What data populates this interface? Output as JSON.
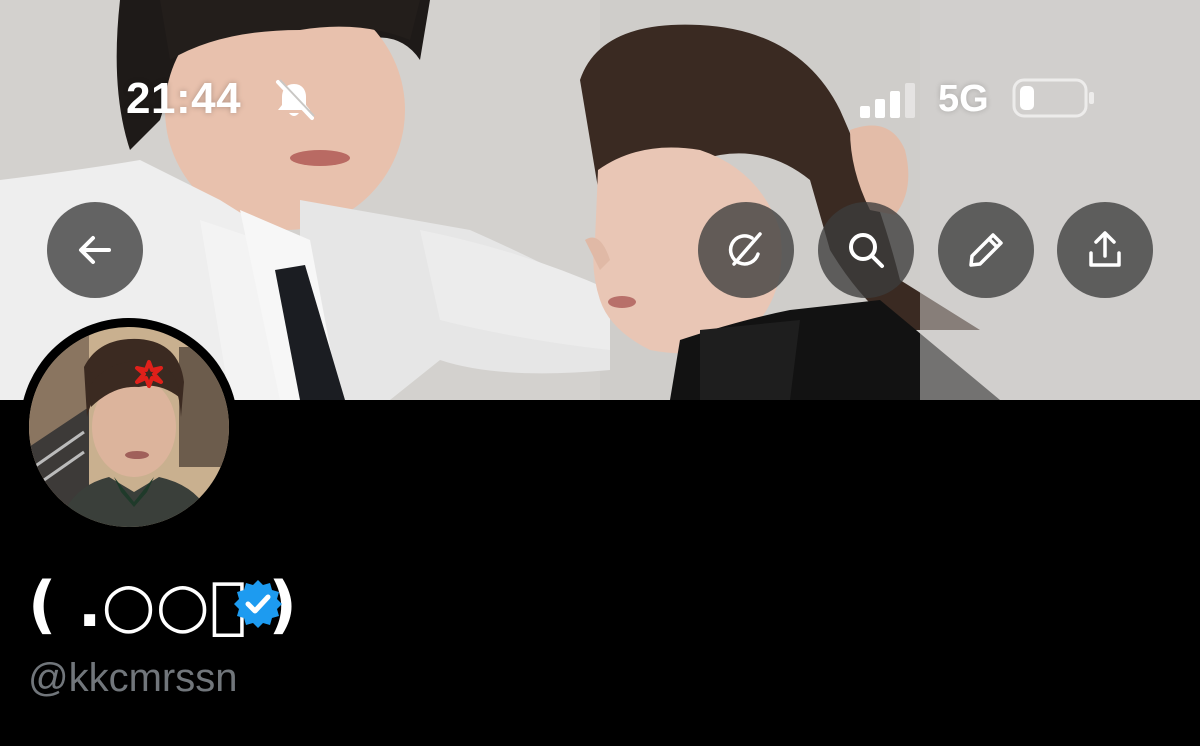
{
  "status_bar": {
    "time": "21:44",
    "network": "5G",
    "silent_icon": "bell-slash-icon",
    "signal_icon": "cellular-signal-icon",
    "battery_icon": "battery-low-icon"
  },
  "toolbar": {
    "back_icon": "arrow-left-icon",
    "grok_icon": "grok-icon",
    "search_icon": "search-icon",
    "edit_icon": "pencil-icon",
    "share_icon": "share-upload-icon"
  },
  "profile": {
    "display_name": "( .○○ᷤ )",
    "handle": "@kkcmrssn",
    "verified": true,
    "verified_color": "#1d9bf0",
    "anger_emoji": "💢"
  },
  "colors": {
    "background": "#000000",
    "handle_text": "#71767b",
    "button_bg": "#3c3c3c"
  }
}
